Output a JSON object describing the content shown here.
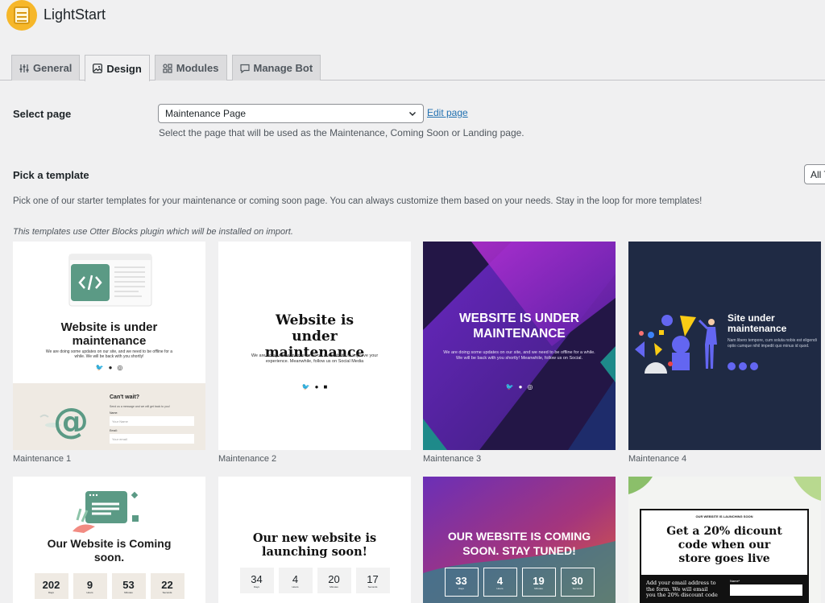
{
  "app": {
    "title": "LightStart"
  },
  "tabs": [
    {
      "label": "General",
      "icon": "sliders-icon"
    },
    {
      "label": "Design",
      "icon": "image-icon"
    },
    {
      "label": "Modules",
      "icon": "grid-icon"
    },
    {
      "label": "Manage Bot",
      "icon": "chat-icon"
    }
  ],
  "select_page": {
    "label": "Select page",
    "value": "Maintenance Page",
    "edit_link": "Edit page",
    "help": "Select the page that will be used as the Maintenance, Coming Soon or Landing page."
  },
  "templates": {
    "label": "Pick a template",
    "filter_value": "All T",
    "help": "Pick one of our starter templates for your maintenance or coming soon page. You can always customize them based on your needs. Stay in the loop for more templates!",
    "note": "This templates use Otter Blocks plugin which will be installed on import."
  },
  "cards": [
    {
      "name": "Maintenance 1",
      "heading": "Website is under maintenance",
      "body": "We are doing some updates on our site, and we need to be offline for a while. We will be back with you shortly!",
      "side_heading": "Can't wait?",
      "side_body": "Send us a message and we will get back to you!",
      "field1_label": "Name:",
      "field1_placeholder": "Your Name",
      "field2_label": "Email:",
      "field2_placeholder": "Your email"
    },
    {
      "name": "Maintenance 2",
      "heading": "Website is under maintenance",
      "body": "We are doing some maintenance on our website to improve your experience. Meanwhile, follow us on Social Media"
    },
    {
      "name": "Maintenance 3",
      "heading": "WEBSITE IS UNDER MAINTENANCE",
      "body": "We are doing some updates on our site, and we need to be offline for a while. We will be back with you shortly! Meanwhile, follow us on Social."
    },
    {
      "name": "Maintenance 4",
      "heading": "Site under maintenance",
      "body": "Nam libero tempore, cum soluta nobis est eligendi optio cumque nihil impedit quo minus id quod."
    },
    {
      "heading": "Our Website is Coming soon.",
      "counts": [
        "202",
        "9",
        "53",
        "22"
      ],
      "count_labels": [
        "Days",
        "Hours",
        "Minutes",
        "Seconds"
      ]
    },
    {
      "heading": "Our new website is launching soon!",
      "counts": [
        "34",
        "4",
        "20",
        "17"
      ],
      "count_labels": [
        "Days",
        "Hours",
        "Minutes",
        "Seconds"
      ]
    },
    {
      "heading": "OUR WEBSITE IS COMING SOON. STAY TUNED!",
      "counts": [
        "33",
        "4",
        "19",
        "30"
      ],
      "count_labels": [
        "Days",
        "Hours",
        "Minutes",
        "Seconds"
      ]
    },
    {
      "eyebrow": "OUR WEBSITE IS LAUNCHING SOON",
      "heading": "Get a 20% dicount code when our store goes live",
      "body": "Add your email address to the form. We will email you the 20% discount code",
      "field_label": "Name*"
    }
  ],
  "colors": {
    "accent": "#2271b1",
    "logo": "#f6b72a",
    "green": "#5b9a85",
    "navy": "#1f2a44",
    "purple": "#3b1e78"
  }
}
